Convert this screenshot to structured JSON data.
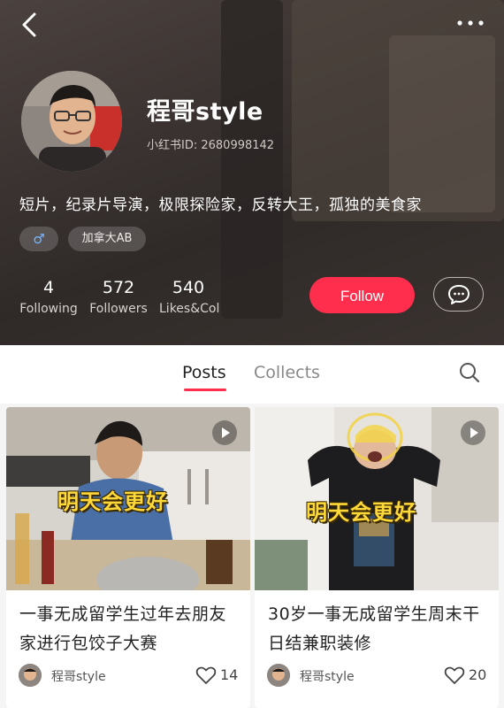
{
  "profile": {
    "username": "程哥style",
    "user_id": "小红书ID: 2680998142",
    "bio": "短片，纪录片导演，极限探险家，反转大王，孤独的美食家",
    "tags": {
      "gender": "♂",
      "location": "加拿大AB"
    },
    "stats": [
      {
        "value": "4",
        "label": "Following"
      },
      {
        "value": "572",
        "label": "Followers"
      },
      {
        "value": "540",
        "label": "Likes&Col"
      }
    ],
    "follow_label": "Follow",
    "accent_color": "#ff2e4d"
  },
  "tabs": [
    {
      "label": "Posts",
      "active": true
    },
    {
      "label": "Collects",
      "active": false
    }
  ],
  "posts": [
    {
      "overlay": "明天会更好",
      "title": "一事无成留学生过年去朋友家进行包饺子大赛",
      "author": "程哥style",
      "likes": "14"
    },
    {
      "overlay": "明天会更好",
      "title": "30岁一事无成留学生周末干日结兼职装修",
      "author": "程哥style",
      "likes": "20"
    }
  ]
}
